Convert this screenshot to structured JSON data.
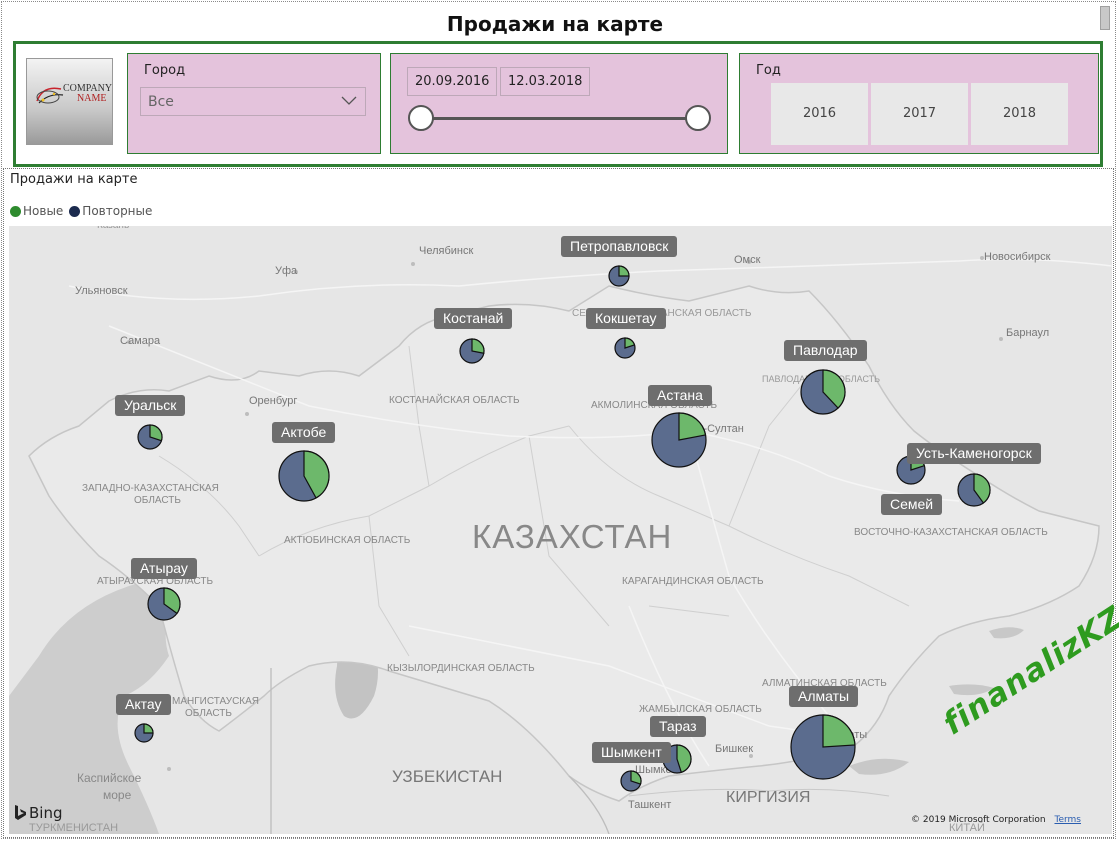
{
  "report": {
    "title": "Продажи на карте"
  },
  "filters": {
    "city": {
      "label": "Город",
      "value": "Все"
    },
    "dates": {
      "start": "20.09.2016",
      "end": "12.03.2018"
    },
    "year": {
      "label": "Год",
      "options": [
        "2016",
        "2017",
        "2018"
      ]
    }
  },
  "logo": {
    "line1": "COMPANY",
    "line2": "NAME"
  },
  "visual": {
    "title": "Продажи на карте",
    "legend": [
      {
        "label": "Новые",
        "color": "#2e8b2e"
      },
      {
        "label": "Повторные",
        "color": "#1b2a4e"
      }
    ]
  },
  "colors": {
    "new": "#6db86b",
    "repeat": "#5b6c8e",
    "filter_border": "#2e7d32",
    "panel_bg": "#e4c3dc"
  },
  "map": {
    "country_label": "КАЗАХСТАН",
    "place_labels": {
      "p1": "Казань",
      "p2": "Челябинск",
      "p3": "Уфа",
      "p4": "Ульяновск",
      "p5": "Самара",
      "p6": "Оренбург",
      "p7": "Омск",
      "p8": "Новосибирск",
      "p9": "Барнаул",
      "p10": "Нур-Султан",
      "p11": "КОСТАНАЙСКАЯ ОБЛАСТЬ",
      "p12": "АКМОЛИНСКАЯ ОБЛАСТЬ",
      "p13": "СЕВЕРО-КАЗАХСТАНСКАЯ ОБЛАСТЬ",
      "p14": "ПАВЛОДАРСКАЯ ОБЛАСТЬ",
      "p15": "ЗАПАДНО-КАЗАХСТАНСКАЯ",
      "p16": "ОБЛАСТЬ",
      "p17": "АКТЮБИНСКАЯ ОБЛАСТЬ",
      "p18": "ВОСТОЧНО-КАЗАХСТАНСКАЯ ОБЛАСТЬ",
      "p19": "КАРАГАНДИНСКАЯ ОБЛАСТЬ",
      "p20": "АТЫРАУСКАЯ ОБЛАСТЬ",
      "p21": "МАНГИСТАУСКАЯ",
      "p22": "ОБЛАСТЬ",
      "p23": "КЫЗЫЛОРДИНСКАЯ ОБЛАСТЬ",
      "p24": "ЖАМБЫЛСКАЯ ОБЛАСТЬ",
      "p25": "АЛМАТИНСКАЯ ОБЛАСТЬ",
      "p26": "Алматы",
      "p27": "Бишкек",
      "p28": "Шымкент",
      "p29": "Ташкент",
      "p30": "Каспийское",
      "p31": "море",
      "p32": "УЗБЕКИСТАН",
      "p33": "КИРГИЗИЯ",
      "p34": "ТУРКМЕНИСТАН",
      "p35": "КИТАЙ"
    },
    "attribution": "Bing",
    "copyright": "© 2019 Microsoft Corporation",
    "terms": "Terms"
  },
  "watermark": "finanalizKZ",
  "chart_data": {
    "type": "map-pie",
    "title": "Продажи на карте",
    "series": [
      {
        "name": "Новые"
      },
      {
        "name": "Повторные"
      }
    ],
    "cities": [
      {
        "name": "Петропавловск",
        "new_share": 0.25,
        "size": 1
      },
      {
        "name": "Костанай",
        "new_share": 0.28,
        "size": 1.2
      },
      {
        "name": "Кокшетау",
        "new_share": 0.2,
        "size": 1
      },
      {
        "name": "Павлодар",
        "new_share": 0.38,
        "size": 2.2
      },
      {
        "name": "Уральск",
        "new_share": 0.3,
        "size": 1.2
      },
      {
        "name": "Актобе",
        "new_share": 0.42,
        "size": 2.5
      },
      {
        "name": "Астана",
        "new_share": 0.22,
        "size": 2.7
      },
      {
        "name": "Усть-Каменогорск",
        "new_share": 0.4,
        "size": 1.6
      },
      {
        "name": "Семей",
        "new_share": 0.2,
        "size": 1.4
      },
      {
        "name": "Атырау",
        "new_share": 0.35,
        "size": 1.6
      },
      {
        "name": "Актау",
        "new_share": 0.25,
        "size": 0.9
      },
      {
        "name": "Алматы",
        "new_share": 0.24,
        "size": 3.2
      },
      {
        "name": "Тараз",
        "new_share": 0.45,
        "size": 1.4
      },
      {
        "name": "Шымкент",
        "new_share": 0.3,
        "size": 1
      }
    ]
  }
}
